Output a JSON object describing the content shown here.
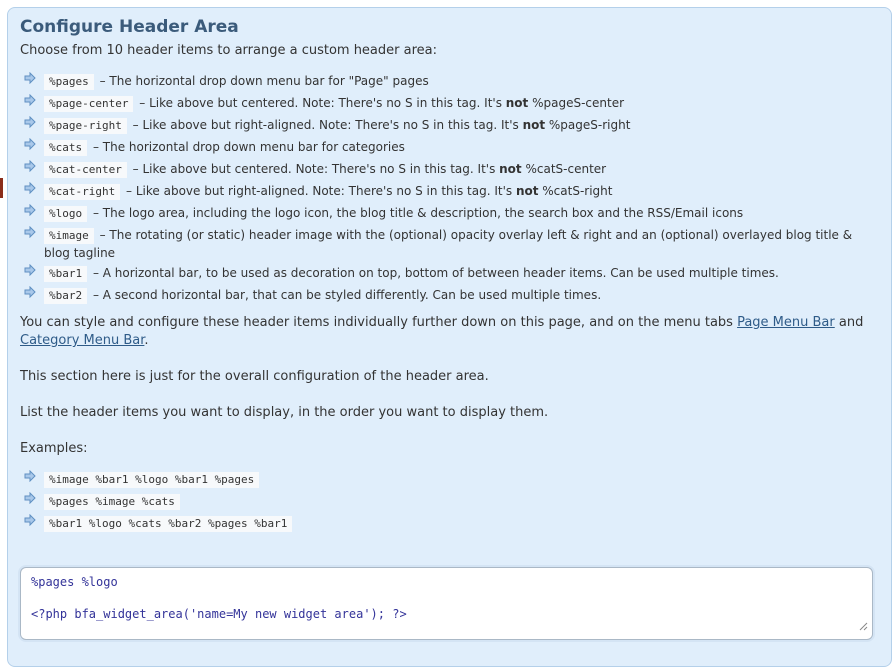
{
  "title": "Configure Header Area",
  "intro": "Choose from 10 header items to arrange a custom header area:",
  "items": [
    {
      "tag": "%pages",
      "desc_a": "The horizontal drop down menu bar for \"Page\" pages",
      "emph": "",
      "desc_b": ""
    },
    {
      "tag": "%page-center",
      "desc_a": "Like above but centered. Note: There's no S in this tag. It's ",
      "emph": "not",
      "desc_b": " %pageS-center"
    },
    {
      "tag": "%page-right",
      "desc_a": "Like above but right-aligned. Note: There's no S in this tag. It's ",
      "emph": "not",
      "desc_b": " %pageS-right"
    },
    {
      "tag": "%cats",
      "desc_a": "The horizontal drop down menu bar for categories",
      "emph": "",
      "desc_b": ""
    },
    {
      "tag": "%cat-center",
      "desc_a": "Like above but centered. Note: There's no S in this tag. It's ",
      "emph": "not",
      "desc_b": " %catS-center"
    },
    {
      "tag": "%cat-right",
      "desc_a": "Like above but right-aligned. Note: There's no S in this tag. It's ",
      "emph": "not",
      "desc_b": " %catS-right"
    },
    {
      "tag": "%logo",
      "desc_a": "The logo area, including the logo icon, the blog title & description, the search box and the RSS/Email icons",
      "emph": "",
      "desc_b": ""
    },
    {
      "tag": "%image",
      "desc_a": "The rotating (or static) header image with the (optional) opacity overlay left & right and an (optional) overlayed blog title & blog tagline",
      "emph": "",
      "desc_b": ""
    },
    {
      "tag": "%bar1",
      "desc_a": "A horizontal bar, to be used as decoration on top, bottom of between header items. Can be used multiple times.",
      "emph": "",
      "desc_b": ""
    },
    {
      "tag": "%bar2",
      "desc_a": "A second horizontal bar, that can be styled differently. Can be used multiple times.",
      "emph": "",
      "desc_b": ""
    }
  ],
  "dash": " – ",
  "style_note": {
    "before": "You can style and configure these header items individually further down on this page, and on the menu tabs ",
    "link1": "Page Menu Bar",
    "between": " and",
    "link2": "Category Menu Bar",
    "after": "."
  },
  "section_note": "This section here is just for the overall configuration of the header area.",
  "list_note": "List the header items you want to display, in the order you want to display them.",
  "examples_label": "Examples:",
  "examples": [
    "%image %bar1 %logo %bar1 %pages",
    "%pages %image %cats",
    "%bar1 %logo %cats %bar2 %pages %bar1"
  ],
  "textarea": {
    "line1": "%pages %logo",
    "line2": "",
    "line3": "<?php bfa_widget_area('name=My new widget area'); ?>"
  },
  "colors": {
    "panel_bg": "#e0eefb",
    "title": "#3b5b7b",
    "link": "#2e5b88",
    "arrow": "#6f9ed0",
    "code_text": "#333399"
  },
  "icons": {
    "bullet": "arrow-right-icon",
    "resize": "resize-grip-icon"
  }
}
